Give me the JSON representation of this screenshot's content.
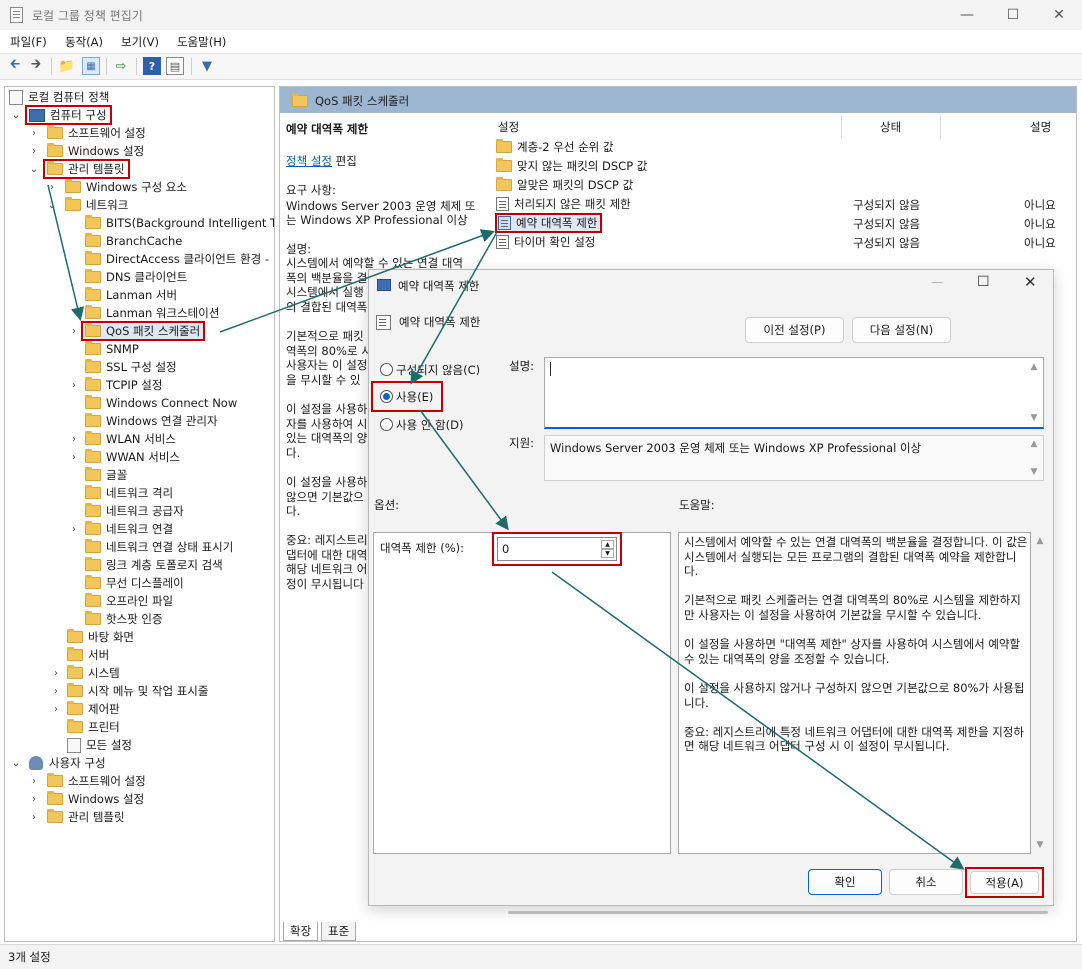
{
  "window": {
    "title": "로컬 그룹 정책 편집기"
  },
  "menu": [
    "파일(F)",
    "동작(A)",
    "보기(V)",
    "도움말(H)"
  ],
  "tree": [
    {
      "label": "로컬 컴퓨터 정책"
    },
    {
      "label": "컴퓨터 구성"
    },
    {
      "label": "소프트웨어 설정"
    },
    {
      "label": "Windows 설정"
    },
    {
      "label": "관리 템플릿"
    },
    {
      "label": "Windows 구성 요소"
    },
    {
      "label": "네트워크"
    },
    {
      "label": "BITS(Background Intelligent Tra"
    },
    {
      "label": "BranchCache"
    },
    {
      "label": "DirectAccess 클라이언트 환경 -"
    },
    {
      "label": "DNS 클라이언트"
    },
    {
      "label": "Lanman 서버"
    },
    {
      "label": "Lanman 워크스테이션"
    },
    {
      "label": "QoS 패킷 스케줄러"
    },
    {
      "label": "SNMP"
    },
    {
      "label": "SSL 구성 설정"
    },
    {
      "label": "TCPIP 설정"
    },
    {
      "label": "Windows Connect Now"
    },
    {
      "label": "Windows 연결 관리자"
    },
    {
      "label": "WLAN 서비스"
    },
    {
      "label": "WWAN 서비스"
    },
    {
      "label": "글꼴"
    },
    {
      "label": "네트워크 격리"
    },
    {
      "label": "네트워크 공급자"
    },
    {
      "label": "네트워크 연결"
    },
    {
      "label": "네트워크 연결 상태 표시기"
    },
    {
      "label": "링크 계층 토폴로지 검색"
    },
    {
      "label": "무선 디스플레이"
    },
    {
      "label": "오프라인 파일"
    },
    {
      "label": "핫스팟 인증"
    },
    {
      "label": "바탕 화면"
    },
    {
      "label": "서버"
    },
    {
      "label": "시스템"
    },
    {
      "label": "시작 메뉴 및 작업 표시줄"
    },
    {
      "label": "제어판"
    },
    {
      "label": "프린터"
    },
    {
      "label": "모든 설정"
    },
    {
      "label": "사용자 구성"
    },
    {
      "label": "소프트웨어 설정"
    },
    {
      "label": "Windows 설정"
    },
    {
      "label": "관리 템플릿"
    }
  ],
  "right": {
    "header": "QoS 패킷 스케줄러",
    "desc_title": "예약 대역폭 제한",
    "edit_link": "정책 설정",
    "edit_suffix": " 편집",
    "req_label": "요구 사항:",
    "req_text1": "Windows Server 2003 운영 체제 또",
    "req_text2": "는 Windows XP Professional 이상",
    "desc_label": "설명:",
    "desc_lines": [
      "시스템에서 예약할 수 있는 연결 대역",
      "폭의 백분율을 결",
      "시스템에서 실행",
      "의 결합된 대역폭",
      "",
      "기본적으로 패킷",
      "역폭의 80%로 시",
      "사용자는 이 설정",
      "을 무시할 수 있",
      "",
      "이 설정을 사용하",
      "자를 사용하여 시",
      "있는 대역폭의 양",
      "다.",
      "",
      "이 설정을 사용하",
      "않으면 기본값으",
      "다.",
      "",
      "중요: 레지스트리",
      "댑터에 대한 대역",
      "해당 네트워크 어",
      "정이 무시됩니다"
    ],
    "col_setting": "설정",
    "col_state": "상태",
    "col_comment": "설명",
    "rows": [
      {
        "name": "계층-2 우선 순위 값",
        "state": "",
        "comment": "",
        "type": "folder"
      },
      {
        "name": "맞지 않는 패킷의 DSCP 값",
        "state": "",
        "comment": "",
        "type": "folder"
      },
      {
        "name": "알맞은 패킷의 DSCP 값",
        "state": "",
        "comment": "",
        "type": "folder"
      },
      {
        "name": "처리되지 않은 패킷 제한",
        "state": "구성되지 않음",
        "comment": "아니요",
        "type": "setting"
      },
      {
        "name": "예약 대역폭 제한",
        "state": "구성되지 않음",
        "comment": "아니요",
        "type": "setting"
      },
      {
        "name": "타이머 확인 설정",
        "state": "구성되지 않음",
        "comment": "아니요",
        "type": "setting"
      }
    ],
    "tabs": [
      "확장",
      "표준"
    ]
  },
  "status": "3개 설정",
  "dialog": {
    "title": "예약 대역폭 제한",
    "subtitle": "예약 대역폭 제한",
    "prev_btn": "이전 설정(P)",
    "next_btn": "다음 설정(N)",
    "opt_not_configured": "구성되지 않음(C)",
    "opt_enabled": "사용(E)",
    "opt_disabled": "사용 안 함(D)",
    "comment_label": "설명:",
    "comment_value": "",
    "support_label": "지원:",
    "support_text": "Windows Server 2003 운영 체제 또는 Windows XP Professional 이상",
    "options_label": "옵션:",
    "help_label": "도움말:",
    "bw_label": "대역폭 제한 (%):",
    "bw_value": "0",
    "help_paragraphs": [
      "시스템에서 예약할 수 있는 연결 대역폭의 백분율을 결정합니다. 이 값은 시스템에서 실행되는 모든 프로그램의 결합된 대역폭 예약을 제한합니다.",
      "기본적으로 패킷 스케줄러는 연결 대역폭의 80%로 시스템을 제한하지만 사용자는 이 설정을 사용하여 기본값을 무시할 수 있습니다.",
      "이 설정을 사용하면 \"대역폭 제한\" 상자를 사용하여 시스템에서 예약할 수 있는 대역폭의 양을 조정할 수 있습니다.",
      "이 설정을 사용하지 않거나 구성하지 않으면 기본값으로 80%가 사용됩니다.",
      "중요: 레지스트리에 특정 네트워크 어댑터에 대한 대역폭 제한을 지정하면 해당 네트워크 어댑터 구성 시 이 설정이 무시됩니다."
    ],
    "ok_btn": "확인",
    "cancel_btn": "취소",
    "apply_btn": "적용(A)"
  },
  "colors": {
    "highlight": "#c00000",
    "arrow": "#1f6b6b",
    "header": "#9cb6d1"
  }
}
